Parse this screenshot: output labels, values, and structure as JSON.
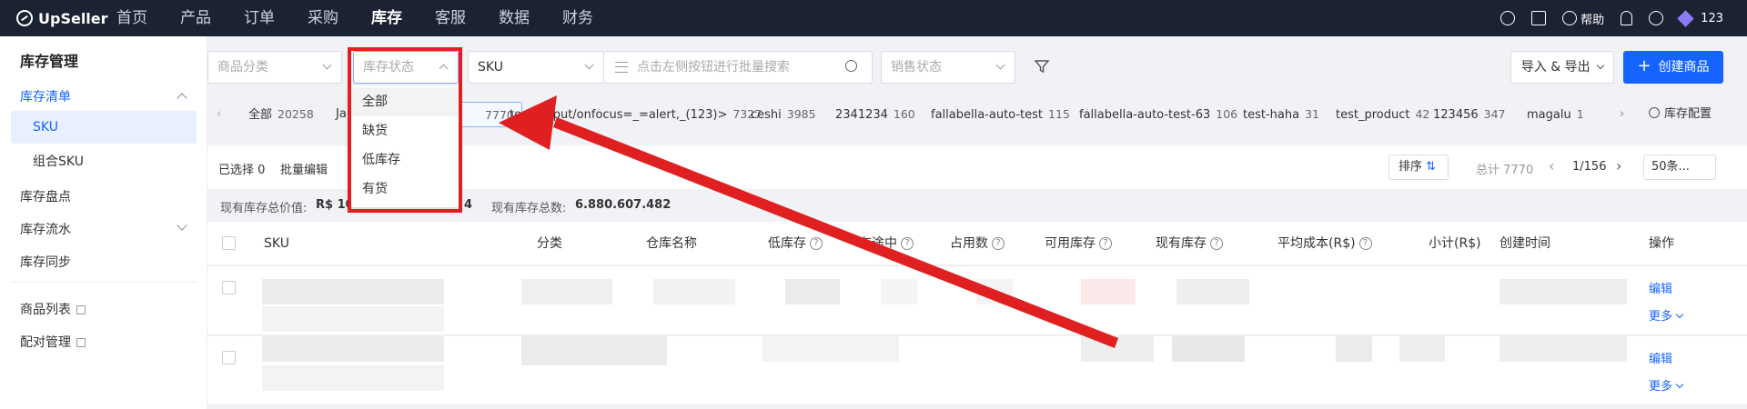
{
  "brand": "UpSeller",
  "nav": [
    "首页",
    "产品",
    "订单",
    "采购",
    "库存",
    "客服",
    "数据",
    "财务"
  ],
  "nav_active": "库存",
  "topright": {
    "help": "帮助",
    "user": "123"
  },
  "sidebar": {
    "title": "库存管理",
    "items": [
      {
        "label": "库存清单"
      },
      {
        "label": "SKU"
      },
      {
        "label": "组合SKU"
      },
      {
        "label": "库存盘点"
      },
      {
        "label": "库存流水"
      },
      {
        "label": "库存同步"
      },
      {
        "label": "商品列表"
      },
      {
        "label": "配对管理"
      }
    ]
  },
  "filters": {
    "category_placeholder": "商品分类",
    "stock_status_placeholder": "库存状态",
    "sku_type": "SKU",
    "search_placeholder": "点击左侧按钮进行批量搜索",
    "sales_status_placeholder": "销售状态"
  },
  "actions": {
    "import_export": "导入 & 导出",
    "create": "创建商品"
  },
  "tabs": [
    {
      "label": "全部",
      "count": "20258"
    },
    {
      "label": "Ja",
      "count": ""
    },
    {
      "label": "",
      "count": "7770"
    },
    {
      "label": "test<input/onfocus=_=alert,_(123)>",
      "count": "7327"
    },
    {
      "label": "ceshi",
      "count": "3985"
    },
    {
      "label": "2341234",
      "count": "160"
    },
    {
      "label": "fallabella-auto-test",
      "count": "115"
    },
    {
      "label": "fallabella-auto-test-63",
      "count": "106"
    },
    {
      "label": "test-haha",
      "count": "31"
    },
    {
      "label": "test_product",
      "count": "42"
    },
    {
      "label": "123456",
      "count": "347"
    },
    {
      "label": "magalu",
      "count": "1"
    }
  ],
  "tab_settings": "库存配置",
  "toolbar": {
    "selected": "已选择 0",
    "batch_edit": "批量编辑",
    "sort": "排序",
    "total": "总计 7770",
    "page": "1/156",
    "page_size": "50条..."
  },
  "summary": {
    "value_label": "现有库存总价值:",
    "value": "R$ 10",
    "value_tail": "4",
    "qty_label": "现有库存总数:",
    "qty": "6.880.607.482"
  },
  "columns": [
    "SKU",
    "分类",
    "仓库名称",
    "低库存",
    "在途中",
    "占用数",
    "可用库存",
    "现有库存",
    "平均成本(R$)",
    "小计(R$)",
    "创建时间",
    "操作"
  ],
  "row_actions": {
    "edit": "编辑",
    "more": "更多"
  },
  "dropdown_options": [
    "全部",
    "缺货",
    "低库存",
    "有货"
  ],
  "colors": {
    "topbar": "#1b2232",
    "primary": "#1664ff",
    "annotation": "#e02020"
  }
}
